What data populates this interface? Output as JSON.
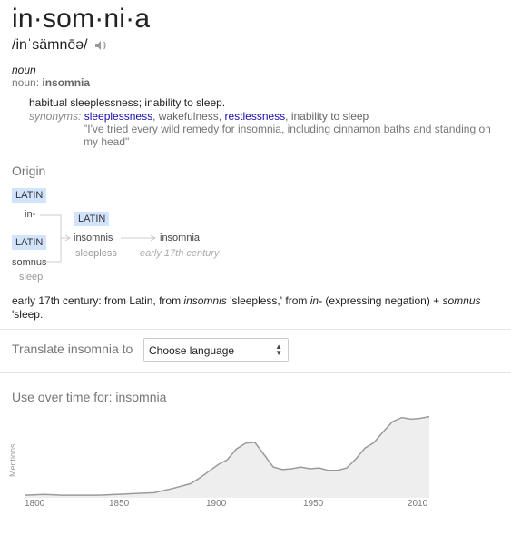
{
  "headword": "in·som·ni·a",
  "pronunciation": "/inˈsämnēə/",
  "pos": "noun",
  "noun_line": {
    "prefix": "noun:",
    "word": "insomnia"
  },
  "definition": "habitual sleeplessness; inability to sleep.",
  "synonyms": {
    "label": "synonyms:",
    "items": [
      {
        "text": "sleeplessness",
        "link": true
      },
      {
        "text": "wakefulness",
        "link": false
      },
      {
        "text": "restlessness",
        "link": true
      },
      {
        "text": "inability to sleep",
        "link": false
      }
    ]
  },
  "example": "\"I've tried every wild remedy for insomnia, including cinnamon baths and standing on my head\"",
  "origin": {
    "heading": "Origin",
    "tags": {
      "latin1": "LATIN",
      "latin2": "LATIN",
      "latin3": "LATIN"
    },
    "in_prefix": "in-",
    "somnus": "somnus",
    "somnus_gloss": "sleep",
    "insomnis": "insomnis",
    "insomnis_gloss": "sleepless",
    "result": "insomnia",
    "result_date": "early 17th century",
    "text_parts": {
      "p1": "early 17th century: from Latin, from ",
      "i1": "insomnis",
      "p2": " 'sleepless,' from ",
      "i2": "in-",
      "p3": " (expressing negation) + ",
      "i3": "somnus",
      "p4": "'sleep.'"
    }
  },
  "translate": {
    "label": "Translate insomnia to",
    "select_value": "Choose language"
  },
  "usage": {
    "heading": "Use over time for: insomnia",
    "y_axis_label": "Mentions",
    "x_ticks": [
      "1800",
      "1850",
      "1900",
      "1950",
      "2010"
    ]
  },
  "chart_data": {
    "type": "area",
    "x": [
      1790,
      1800,
      1810,
      1820,
      1830,
      1840,
      1850,
      1860,
      1870,
      1880,
      1885,
      1890,
      1895,
      1900,
      1905,
      1910,
      1915,
      1920,
      1925,
      1930,
      1935,
      1940,
      1945,
      1950,
      1955,
      1960,
      1965,
      1970,
      1975,
      1980,
      1985,
      1990,
      1995,
      2000,
      2005,
      2010
    ],
    "y": [
      0.01,
      0.02,
      0.01,
      0.01,
      0.01,
      0.02,
      0.03,
      0.04,
      0.09,
      0.15,
      0.22,
      0.3,
      0.38,
      0.44,
      0.57,
      0.64,
      0.65,
      0.5,
      0.35,
      0.32,
      0.33,
      0.35,
      0.33,
      0.34,
      0.31,
      0.31,
      0.34,
      0.45,
      0.58,
      0.65,
      0.78,
      0.9,
      0.95,
      0.93,
      0.94,
      0.96
    ],
    "xlim": [
      1790,
      2010
    ],
    "ylim": [
      0,
      1
    ],
    "ylabel": "Mentions",
    "grid": false,
    "color": "#eeeeee"
  }
}
